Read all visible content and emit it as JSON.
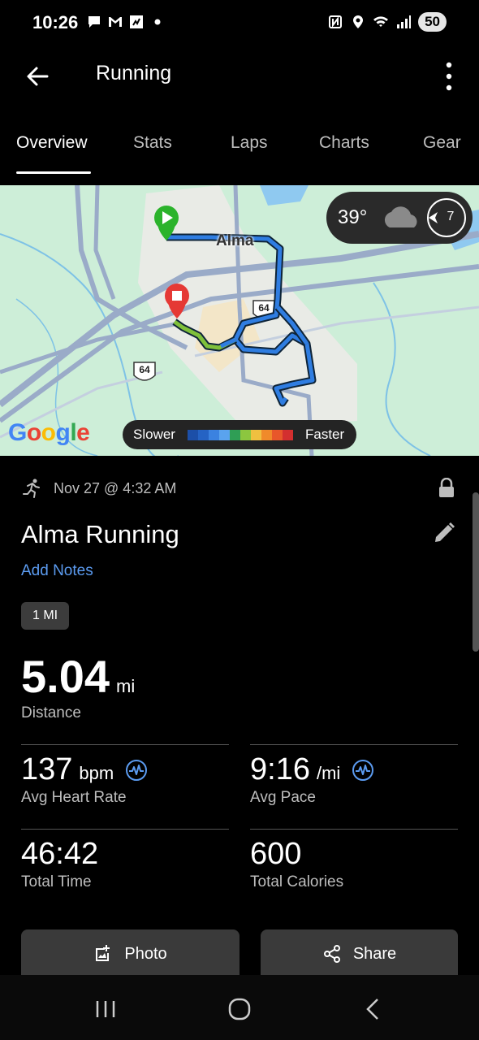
{
  "status_bar": {
    "time": "10:26",
    "battery": "50",
    "left_icons": [
      "messages-icon",
      "gmail-icon",
      "fitness-app-icon",
      "dot-icon"
    ],
    "right_icons": [
      "nfc-icon",
      "location-icon",
      "wifi-icon",
      "signal-icon"
    ]
  },
  "app_bar": {
    "title": "Running"
  },
  "tabs": [
    {
      "label": "Overview",
      "active": true
    },
    {
      "label": "Stats",
      "active": false
    },
    {
      "label": "Laps",
      "active": false
    },
    {
      "label": "Charts",
      "active": false
    },
    {
      "label": "Gear",
      "active": false
    }
  ],
  "map": {
    "place_label": "Alma",
    "route_shield_1": "64",
    "route_shield_2": "64",
    "weather_temp": "39°",
    "wind_speed": "7",
    "google_logo": "Google",
    "speed_legend": {
      "slower": "Slower",
      "faster": "Faster"
    },
    "speed_colors": [
      "#1c4fa8",
      "#2563c4",
      "#3b82e0",
      "#5aa3ee",
      "#2f9e55",
      "#8cc63f",
      "#f0c040",
      "#f08a2a",
      "#e8572a",
      "#d32f2f"
    ]
  },
  "activity": {
    "date": "Nov 27 @ 4:32 AM",
    "title": "Alma Running",
    "add_notes": "Add Notes",
    "chip": "1 MI",
    "distance": {
      "value": "5.04",
      "unit": "mi",
      "label": "Distance"
    },
    "heart_rate": {
      "value": "137",
      "unit": "bpm",
      "label": "Avg Heart Rate"
    },
    "pace": {
      "value": "9:16",
      "unit": "/mi",
      "label": "Avg Pace"
    },
    "time": {
      "value": "46:42",
      "label": "Total Time"
    },
    "calories": {
      "value": "600",
      "label": "Total Calories"
    }
  },
  "buttons": {
    "photo": "Photo",
    "share": "Share"
  },
  "colors": {
    "link": "#5b9bf0",
    "route": "#2f7de1",
    "route_fast": "#7fc03a",
    "start": "#2bb32b",
    "end": "#e53935"
  }
}
